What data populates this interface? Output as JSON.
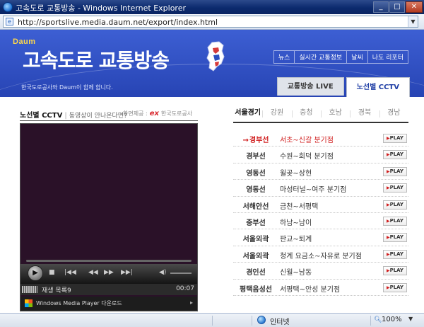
{
  "window": {
    "title": "고속도로 교통방송 - Windows Internet Explorer",
    "minimize": "_",
    "maximize": "□",
    "close": "✕"
  },
  "address": {
    "url": "http://sportslive.media.daum.net/export/index.html"
  },
  "header": {
    "brand": "Daum",
    "site_title": "고속도로 교통방송",
    "subtitle": "한국도로공사와 Daum이 함께 합니다.",
    "nav": [
      "뉴스",
      "실시간 교통정보",
      "날씨",
      "나도 리포터"
    ],
    "tabs": [
      {
        "label": "교통방송 LIVE",
        "active": false
      },
      {
        "label": "노선별 CCTV",
        "active": true
      }
    ]
  },
  "cctv": {
    "title": "노선별 CCTV",
    "question": "동영상이 안나온다면?",
    "provider_label": "화면제공 :",
    "provider_logo": "ex",
    "provider_name": "한국도로공사",
    "player": {
      "status_text": "재생 목록9",
      "time": "00:07",
      "wmp_download": "Windows Media Player 다운로드"
    }
  },
  "regions": [
    {
      "label": "서울경기",
      "active": true
    },
    {
      "label": "강원",
      "active": false
    },
    {
      "label": "충청",
      "active": false
    },
    {
      "label": "호남",
      "active": false
    },
    {
      "label": "경북",
      "active": false
    },
    {
      "label": "경남",
      "active": false
    }
  ],
  "routes": [
    {
      "road": "경부선",
      "section": "서초~신갈 분기점",
      "selected": true
    },
    {
      "road": "경부선",
      "section": "수원~회덕 분기점",
      "selected": false
    },
    {
      "road": "영동선",
      "section": "월곶~상현",
      "selected": false
    },
    {
      "road": "영동선",
      "section": "마성터널~여주 분기점",
      "selected": false
    },
    {
      "road": "서해안선",
      "section": "금천~서평택",
      "selected": false
    },
    {
      "road": "중부선",
      "section": "하남~남이",
      "selected": false
    },
    {
      "road": "서울외곽",
      "section": "판교~퇴계",
      "selected": false
    },
    {
      "road": "서울외곽",
      "section": "청계 요금소~자유로 분기점",
      "selected": false
    },
    {
      "road": "경인선",
      "section": "신월~남동",
      "selected": false
    },
    {
      "road": "평택음성선",
      "section": "서평택~안성 분기점",
      "selected": false
    }
  ],
  "play_label": "PLAY",
  "statusbar": {
    "zone": "인터넷",
    "zoom": "100%"
  }
}
